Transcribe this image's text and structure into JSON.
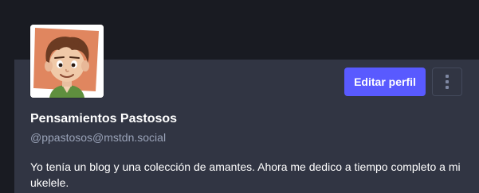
{
  "profile": {
    "display_name": "Pensamientos Pastosos",
    "handle": "@ppastosos@mstdn.social",
    "bio": "Yo tenía un blog y una colección de amantes. Ahora me dedico a tiempo completo a mi ukelele.",
    "avatar_icon": "cartoon-avatar-icon"
  },
  "actions": {
    "edit_label": "Editar perfil",
    "more_icon": "vertical-ellipsis-icon"
  },
  "colors": {
    "background": "#191b22",
    "card": "#313543",
    "accent": "#595aff",
    "secondary_text": "#9aa3b8"
  }
}
